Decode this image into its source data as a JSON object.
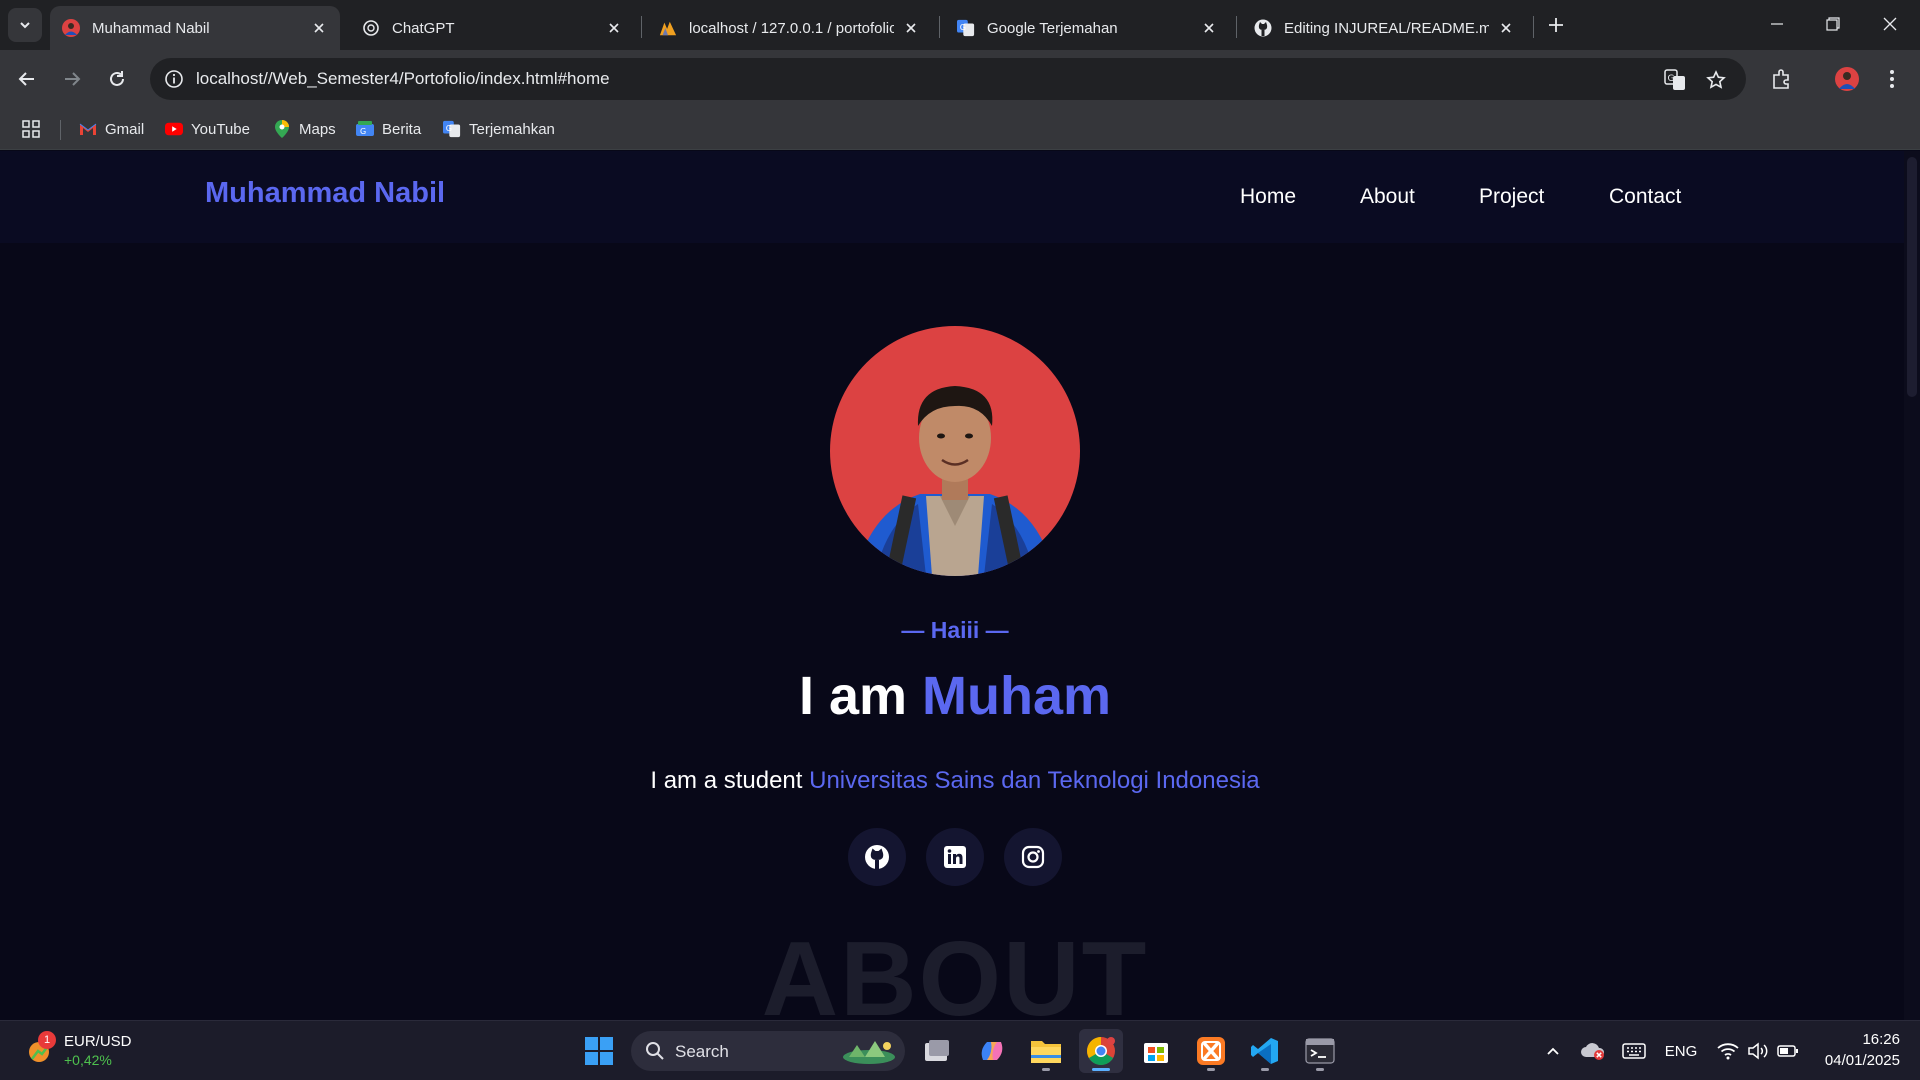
{
  "browser": {
    "tabs": [
      {
        "title": "Muhammad Nabil",
        "icon": "avatar-favicon",
        "active": true
      },
      {
        "title": "ChatGPT",
        "icon": "chatgpt-icon",
        "active": false
      },
      {
        "title": "localhost / 127.0.0.1 / portofolio",
        "icon": "phpmyadmin-icon",
        "active": false
      },
      {
        "title": "Google Terjemahan",
        "icon": "google-translate-icon",
        "active": false
      },
      {
        "title": "Editing INJUREAL/README.md",
        "icon": "github-icon",
        "active": false
      }
    ],
    "address": "localhost//Web_Semester4/Portofolio/index.html#home",
    "bookmarks": [
      "Gmail",
      "YouTube",
      "Maps",
      "Berita",
      "Terjemahkan"
    ]
  },
  "site": {
    "brand": "Muhammad Nabil",
    "nav": [
      "Home",
      "About",
      "Project",
      "Contact"
    ],
    "greeting": "— Haiii —",
    "headline_prefix": "I am ",
    "headline_accent": "Muham",
    "tagline_prefix": "I am a student ",
    "tagline_university": "Universitas Sains dan Teknologi Indonesia",
    "socials": [
      "github-icon",
      "linkedin-icon",
      "instagram-icon"
    ],
    "next_section_title": "ABOUT",
    "colors": {
      "accent": "#5b68f0",
      "background": "#080818",
      "avatar_bg": "#dc4242"
    }
  },
  "taskbar": {
    "widget_title": "EUR/USD",
    "widget_change": "+0,42%",
    "widget_badge": "1",
    "search_label": "Search",
    "language": "ENG",
    "time": "16:26",
    "date": "04/01/2025"
  }
}
